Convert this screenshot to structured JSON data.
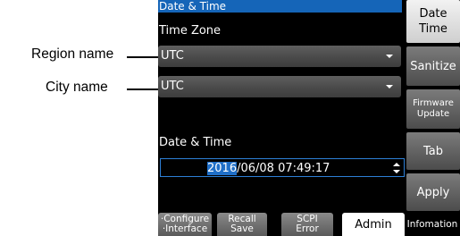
{
  "callouts": {
    "region": "Region name",
    "city": "City name"
  },
  "panel": {
    "header": "Date & Time",
    "timezone_label": "Time Zone",
    "region_value": "UTC",
    "city_value": "UTC",
    "datetime_label": "Date & Time",
    "datetime": {
      "highlighted_part": "2016",
      "rest": "/06/08 07:49:17"
    }
  },
  "softkeys": {
    "date_time": [
      "Date",
      "Time"
    ],
    "sanitize": "Sanitize",
    "firmware_update": [
      "Firmware",
      "Update"
    ],
    "tab": "Tab",
    "apply": "Apply"
  },
  "tabs": {
    "configure_interface": [
      "·Configure",
      "·Interface"
    ],
    "recall_save": [
      "Recall",
      "Save"
    ],
    "scpi_error": [
      "SCPI",
      "Error"
    ],
    "admin": "Admin",
    "information": "Infomation"
  },
  "colors": {
    "header_bg": "#1565b8",
    "highlight": "#1f6fc8",
    "screen_bg": "#000000"
  }
}
